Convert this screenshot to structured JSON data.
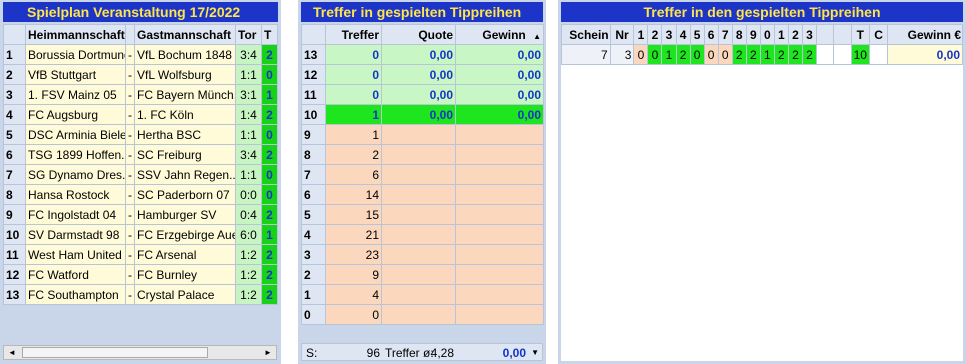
{
  "spielplan": {
    "title": "Spielplan Veranstaltung 17/2022",
    "headers": {
      "home": "Heimmannschaft",
      "away": "Gastmannschaft",
      "score": "Tor",
      "tendency": "T"
    },
    "dash": "-",
    "rows": [
      {
        "nr": "1",
        "home": "Borussia Dortmund",
        "away": "VfL Bochum 1848",
        "score": "3:4",
        "t": "2"
      },
      {
        "nr": "2",
        "home": "VfB Stuttgart",
        "away": "VfL Wolfsburg",
        "score": "1:1",
        "t": "0"
      },
      {
        "nr": "3",
        "home": "1. FSV Mainz 05",
        "away": "FC Bayern Münch...",
        "score": "3:1",
        "t": "1"
      },
      {
        "nr": "4",
        "home": "FC Augsburg",
        "away": "1. FC Köln",
        "score": "1:4",
        "t": "2"
      },
      {
        "nr": "5",
        "home": "DSC Arminia Biele...",
        "away": "Hertha BSC",
        "score": "1:1",
        "t": "0"
      },
      {
        "nr": "6",
        "home": "TSG 1899 Hoffen...",
        "away": "SC Freiburg",
        "score": "3:4",
        "t": "2"
      },
      {
        "nr": "7",
        "home": "SG Dynamo Dres...",
        "away": "SSV Jahn Regen...",
        "score": "1:1",
        "t": "0"
      },
      {
        "nr": "8",
        "home": "Hansa Rostock",
        "away": "SC Paderborn 07",
        "score": "0:0",
        "t": "0"
      },
      {
        "nr": "9",
        "home": "FC Ingolstadt 04",
        "away": "Hamburger SV",
        "score": "0:4",
        "t": "2"
      },
      {
        "nr": "10",
        "home": "SV Darmstadt 98",
        "away": "FC Erzgebirge Aue",
        "score": "6:0",
        "t": "1"
      },
      {
        "nr": "11",
        "home": "West Ham United",
        "away": "FC Arsenal",
        "score": "1:2",
        "t": "2"
      },
      {
        "nr": "12",
        "home": "FC Watford",
        "away": "FC Burnley",
        "score": "1:2",
        "t": "2"
      },
      {
        "nr": "13",
        "home": "FC Southampton",
        "away": "Crystal Palace",
        "score": "1:2",
        "t": "2"
      }
    ]
  },
  "treffer": {
    "title": "Treffer in gespielten Tippreihen",
    "headers": {
      "treffer": "Treffer",
      "quote": "Quote",
      "gewinn": "Gewinn",
      "sort_icon": "▲"
    },
    "rows": [
      {
        "level": "13",
        "treffer": "0",
        "quote": "0,00",
        "gewinn": "0,00",
        "style": "hi"
      },
      {
        "level": "12",
        "treffer": "0",
        "quote": "0,00",
        "gewinn": "0,00",
        "style": "hi"
      },
      {
        "level": "11",
        "treffer": "0",
        "quote": "0,00",
        "gewinn": "0,00",
        "style": "hi"
      },
      {
        "level": "10",
        "treffer": "1",
        "quote": "0,00",
        "gewinn": "0,00",
        "style": "top"
      },
      {
        "level": "9",
        "treffer": "1",
        "quote": "",
        "gewinn": "",
        "style": "lo"
      },
      {
        "level": "8",
        "treffer": "2",
        "quote": "",
        "gewinn": "",
        "style": "lo"
      },
      {
        "level": "7",
        "treffer": "6",
        "quote": "",
        "gewinn": "",
        "style": "lo"
      },
      {
        "level": "6",
        "treffer": "14",
        "quote": "",
        "gewinn": "",
        "style": "lo"
      },
      {
        "level": "5",
        "treffer": "15",
        "quote": "",
        "gewinn": "",
        "style": "lo"
      },
      {
        "level": "4",
        "treffer": "21",
        "quote": "",
        "gewinn": "",
        "style": "lo"
      },
      {
        "level": "3",
        "treffer": "23",
        "quote": "",
        "gewinn": "",
        "style": "lo"
      },
      {
        "level": "2",
        "treffer": "9",
        "quote": "",
        "gewinn": "",
        "style": "lo"
      },
      {
        "level": "1",
        "treffer": "4",
        "quote": "",
        "gewinn": "",
        "style": "lo"
      },
      {
        "level": "0",
        "treffer": "0",
        "quote": "",
        "gewinn": "",
        "style": "lo"
      }
    ],
    "footer": {
      "s_label": "S:",
      "sum": "96",
      "avg_label": "Treffer ø:",
      "avg": "4,28",
      "gewinn": "0,00",
      "dropdown_icon": "▼"
    }
  },
  "tippreihen": {
    "title": "Treffer in den gespielten Tippreihen",
    "headers": [
      "Schein",
      "Nr",
      "1",
      "2",
      "3",
      "4",
      "5",
      "6",
      "7",
      "8",
      "9",
      "0",
      "1",
      "2",
      "3",
      "",
      "",
      "T",
      "C",
      "Gewinn €"
    ],
    "row": {
      "schein": "7",
      "nr": "3",
      "cells": [
        "0",
        "0",
        "1",
        "2",
        "0",
        "0",
        "0",
        "2",
        "2",
        "1",
        "2",
        "2",
        "2"
      ],
      "cell_styles": [
        "lo",
        "hi",
        "hi",
        "hi",
        "hi",
        "lo",
        "lo",
        "hi",
        "hi",
        "hi",
        "hi",
        "hi",
        "hi"
      ],
      "t": "10",
      "c": "",
      "gewinn": "0,00"
    }
  },
  "scrollbar": {
    "left_icon": "◄",
    "right_icon": "►"
  }
}
